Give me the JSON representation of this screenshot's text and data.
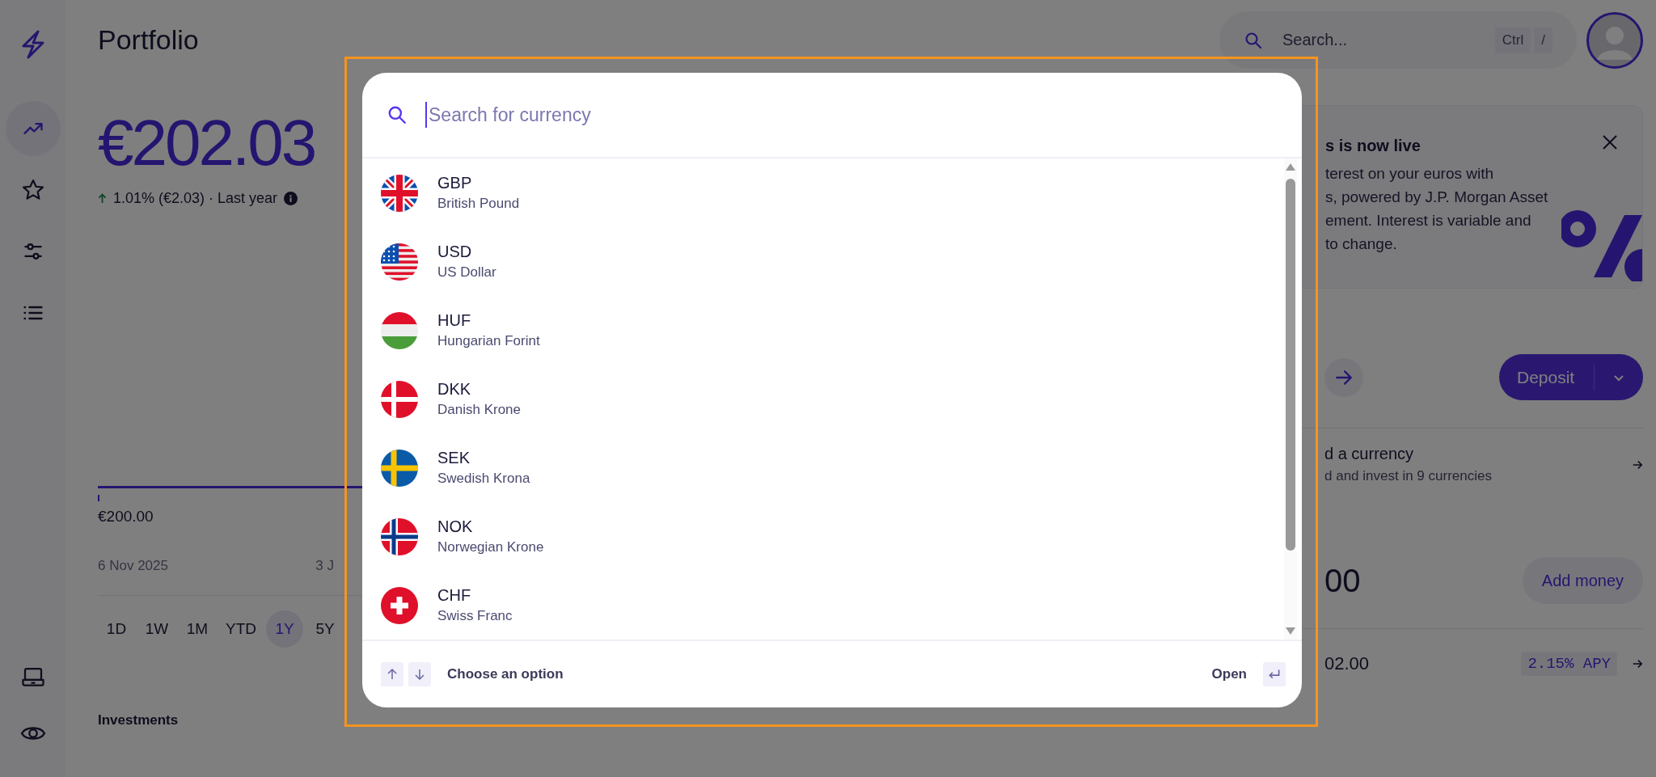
{
  "sidebar": {
    "items": [
      {
        "selected": true
      },
      {
        "selected": false
      },
      {
        "selected": false
      },
      {
        "selected": false
      },
      {
        "selected": false
      },
      {
        "selected": false
      }
    ]
  },
  "page_title": "Portfolio",
  "search": {
    "placeholder": "Search...",
    "shortcut": [
      "Ctrl",
      "/"
    ]
  },
  "balance": {
    "amount": "€202.03",
    "change": "1.01% (€2.03) · Last year"
  },
  "chart": {
    "value_label": "€200.00",
    "dates": [
      "6 Nov 2025",
      "3 J"
    ]
  },
  "ranges": [
    {
      "label": "1D",
      "selected": false
    },
    {
      "label": "1W",
      "selected": false
    },
    {
      "label": "1M",
      "selected": false
    },
    {
      "label": "YTD",
      "selected": false
    },
    {
      "label": "1Y",
      "selected": true
    },
    {
      "label": "5Y",
      "selected": false
    }
  ],
  "investments": {
    "label": "Investments"
  },
  "promo": {
    "title": "s is now live",
    "lines": [
      "terest on your euros with",
      "s, powered by J.P. Morgan Asset",
      "ement. Interest is variable and",
      "to change."
    ]
  },
  "deposit": {
    "label": "Deposit"
  },
  "currency_link": {
    "title": "d a currency",
    "subtitle": "d and invest in 9 currencies"
  },
  "cash": {
    "amount": "00",
    "button": "Add money"
  },
  "interest": {
    "amount": "02.00",
    "badge": "2.15% APY"
  },
  "dialog": {
    "search_placeholder": "Search for currency",
    "currencies": [
      {
        "code": "GBP",
        "name": "British Pound"
      },
      {
        "code": "USD",
        "name": "US Dollar"
      },
      {
        "code": "HUF",
        "name": "Hungarian Forint"
      },
      {
        "code": "DKK",
        "name": "Danish Krone"
      },
      {
        "code": "SEK",
        "name": "Swedish Krona"
      },
      {
        "code": "NOK",
        "name": "Norwegian Krone"
      },
      {
        "code": "CHF",
        "name": "Swiss Franc"
      }
    ],
    "footer": {
      "hint": "Choose an option",
      "action": "Open"
    }
  }
}
